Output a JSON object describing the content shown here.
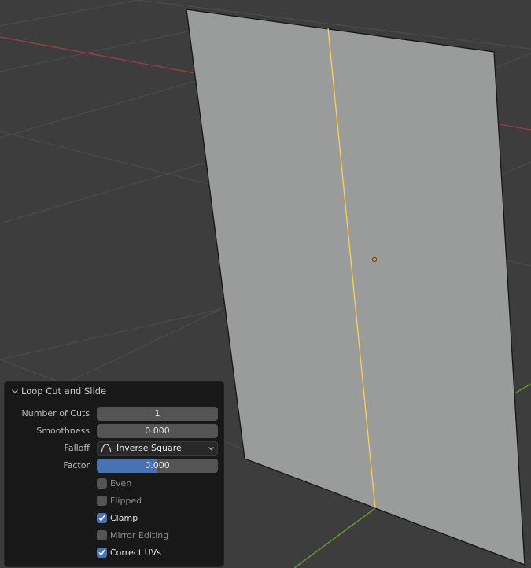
{
  "viewport": {
    "background": "#3d3d3d",
    "plane_color": "#9a9c9c",
    "loop_cut_color": "#ffd23a",
    "x_axis_color": "#9a3a45",
    "y_axis_color": "#6a9a2a",
    "vertex_color": "#ff9a1f"
  },
  "panel": {
    "title": "Loop Cut and Slide",
    "fields": {
      "number_of_cuts": {
        "label": "Number of Cuts",
        "value": "1"
      },
      "smoothness": {
        "label": "Smoothness",
        "value": "0.000"
      },
      "falloff": {
        "label": "Falloff",
        "value": "Inverse Square",
        "icon": "inverse-square-curve-icon"
      },
      "factor": {
        "label": "Factor",
        "value": "0.000",
        "slider_fraction": 0.5
      }
    },
    "checkboxes": [
      {
        "label": "Even",
        "checked": false
      },
      {
        "label": "Flipped",
        "checked": false
      },
      {
        "label": "Clamp",
        "checked": true
      },
      {
        "label": "Mirror Editing",
        "checked": false
      },
      {
        "label": "Correct UVs",
        "checked": true
      }
    ],
    "accent": "#4772b3"
  }
}
